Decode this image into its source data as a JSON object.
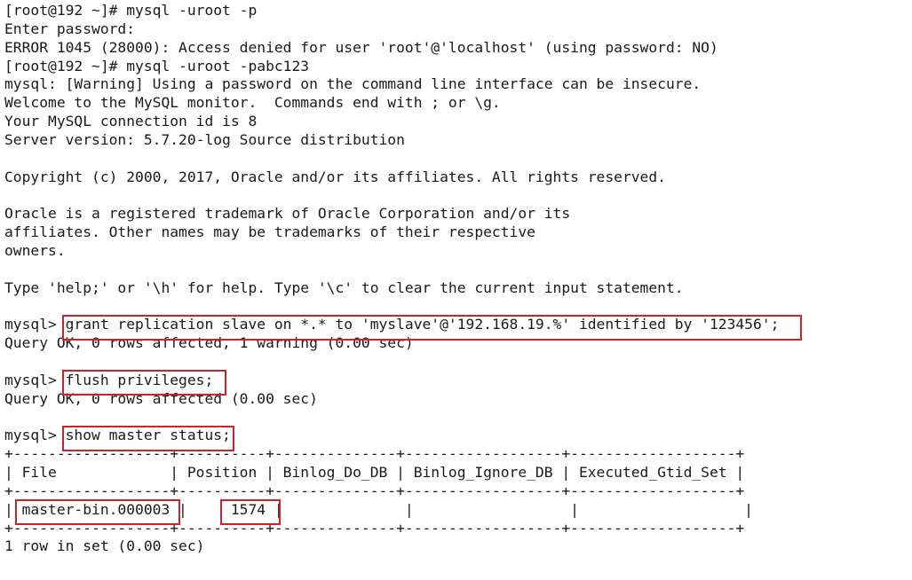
{
  "terminal": {
    "prompt_shell": "[root@192 ~]#",
    "prompt_mysql": "mysql>",
    "lines": [
      "[root@192 ~]# mysql -uroot -p",
      "Enter password:",
      "ERROR 1045 (28000): Access denied for user 'root'@'localhost' (using password: NO)",
      "[root@192 ~]# mysql -uroot -pabc123",
      "mysql: [Warning] Using a password on the command line interface can be insecure.",
      "Welcome to the MySQL monitor.  Commands end with ; or \\g.",
      "Your MySQL connection id is 8",
      "Server version: 5.7.20-log Source distribution",
      "",
      "Copyright (c) 2000, 2017, Oracle and/or its affiliates. All rights reserved.",
      "",
      "Oracle is a registered trademark of Oracle Corporation and/or its",
      "affiliates. Other names may be trademarks of their respective",
      "owners.",
      "",
      "Type 'help;' or '\\h' for help. Type '\\c' to clear the current input statement.",
      "",
      "mysql> grant replication slave on *.* to 'myslave'@'192.168.19.%' identified by '123456';",
      "Query OK, 0 rows affected, 1 warning (0.00 sec)",
      "",
      "mysql> flush privileges;",
      "Query OK, 0 rows affected (0.00 sec)",
      "",
      "mysql> show master status;",
      "+------------------+----------+--------------+------------------+-------------------+",
      "| File             | Position | Binlog_Do_DB | Binlog_Ignore_DB | Executed_Gtid_Set |",
      "+------------------+----------+--------------+------------------+-------------------+",
      "| master-bin.000003 |     1574 |              |                  |                   |",
      "+------------------+----------+--------------+------------------+-------------------+",
      "1 row in set (0.00 sec)"
    ],
    "commands": {
      "login_no_password": "mysql -uroot -p",
      "login_with_password": "mysql -uroot -pabc123",
      "grant": "grant replication slave on *.* to 'myslave'@'192.168.19.%' identified by '123456';",
      "flush": "flush privileges;",
      "show_master_status": "show master status;"
    },
    "error": {
      "code": "ERROR 1045 (28000)",
      "message": "Access denied for user 'root'@'localhost' (using password: NO)"
    },
    "warning": "mysql: [Warning] Using a password on the command line interface can be insecure.",
    "banner": {
      "welcome": "Welcome to the MySQL monitor.  Commands end with ; or \\g.",
      "connection_id": "Your MySQL connection id is 8",
      "server_version": "Server version: 5.7.20-log Source distribution",
      "copyright": "Copyright (c) 2000, 2017, Oracle and/or its affiliates. All rights reserved.",
      "trademark_1": "Oracle is a registered trademark of Oracle Corporation and/or its",
      "trademark_2": "affiliates. Other names may be trademarks of their respective",
      "trademark_3": "owners.",
      "help": "Type 'help;' or '\\h' for help. Type '\\c' to clear the current input statement."
    },
    "results": {
      "grant_result": "Query OK, 0 rows affected, 1 warning (0.00 sec)",
      "flush_result": "Query OK, 0 rows affected (0.00 sec)",
      "row_count": "1 row in set (0.00 sec)"
    },
    "master_status_table": {
      "columns": [
        "File",
        "Position",
        "Binlog_Do_DB",
        "Binlog_Ignore_DB",
        "Executed_Gtid_Set"
      ],
      "rows": [
        [
          "master-bin.000003",
          "1574",
          "",
          "",
          ""
        ]
      ]
    },
    "highlights": [
      {
        "name": "grant-statement-highlight",
        "label": "grant replication slave on *.* to 'myslave'@'192.168.19.%' identified by '123456';"
      },
      {
        "name": "flush-privileges-highlight",
        "label": "flush privileges;"
      },
      {
        "name": "show-master-status-highlight",
        "label": "show master status;"
      },
      {
        "name": "binlog-file-highlight",
        "label": "master-bin.000003"
      },
      {
        "name": "binlog-position-highlight",
        "label": "1574"
      }
    ],
    "colors": {
      "background": "#ffffff",
      "foreground": "#1a1a1a",
      "highlight_border": "#cc2229"
    }
  }
}
